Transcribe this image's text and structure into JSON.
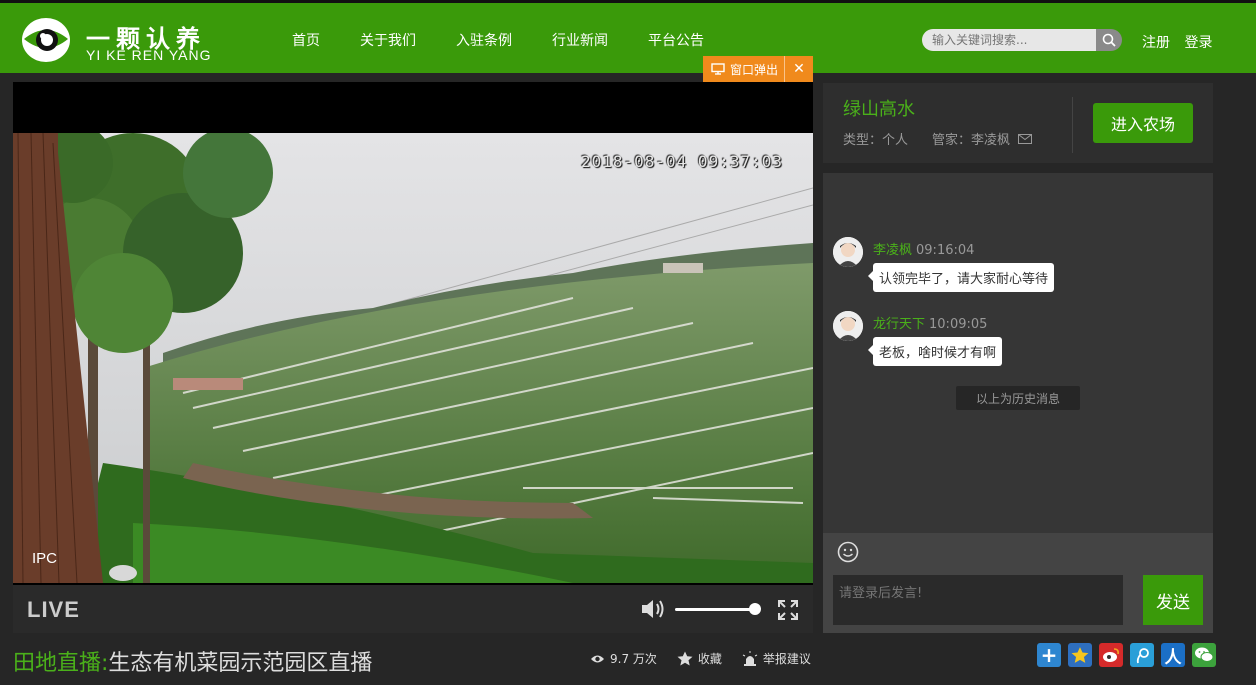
{
  "header": {
    "brand_cn": "一颗认养",
    "brand_en": "YI KE REN YANG",
    "nav": [
      "首页",
      "关于我们",
      "入驻条例",
      "行业新闻",
      "平台公告"
    ],
    "search_placeholder": "输入关键词搜索...",
    "register": "注册",
    "login": "登录"
  },
  "popout": {
    "label": "窗口弹出",
    "close": "✕"
  },
  "video": {
    "timestamp": "2018-08-04 09:37:03",
    "watermark": "IPC",
    "live_label": "LIVE",
    "volume_level": 1.0
  },
  "program": {
    "category": "田地直播:",
    "title": "生态有机菜园示范园区直播",
    "views": "9.7 万次",
    "favorite": "收藏",
    "report": "举报建议"
  },
  "farm": {
    "name": "绿山高水",
    "type": "类型：个人",
    "manager": "管家：李凌枫",
    "enter_button": "进入农场"
  },
  "chat": {
    "messages": [
      {
        "user": "李凌枫",
        "time": "09:16:04",
        "text": "认领完毕了，请大家耐心等待"
      },
      {
        "user": "龙行天下",
        "time": "10:09:05",
        "text": "老板，啥时候才有啊"
      }
    ],
    "history_notice": "以上为历史消息",
    "input_placeholder": "请登录后发言!",
    "send": "发送"
  },
  "colors": {
    "brand_green": "#3a9a0a",
    "accent_orange": "#f08a1c"
  },
  "share_icons": [
    "plus-share-icon",
    "qzone-icon",
    "weibo-icon",
    "tencent-weibo-icon",
    "renren-icon",
    "wechat-icon"
  ]
}
